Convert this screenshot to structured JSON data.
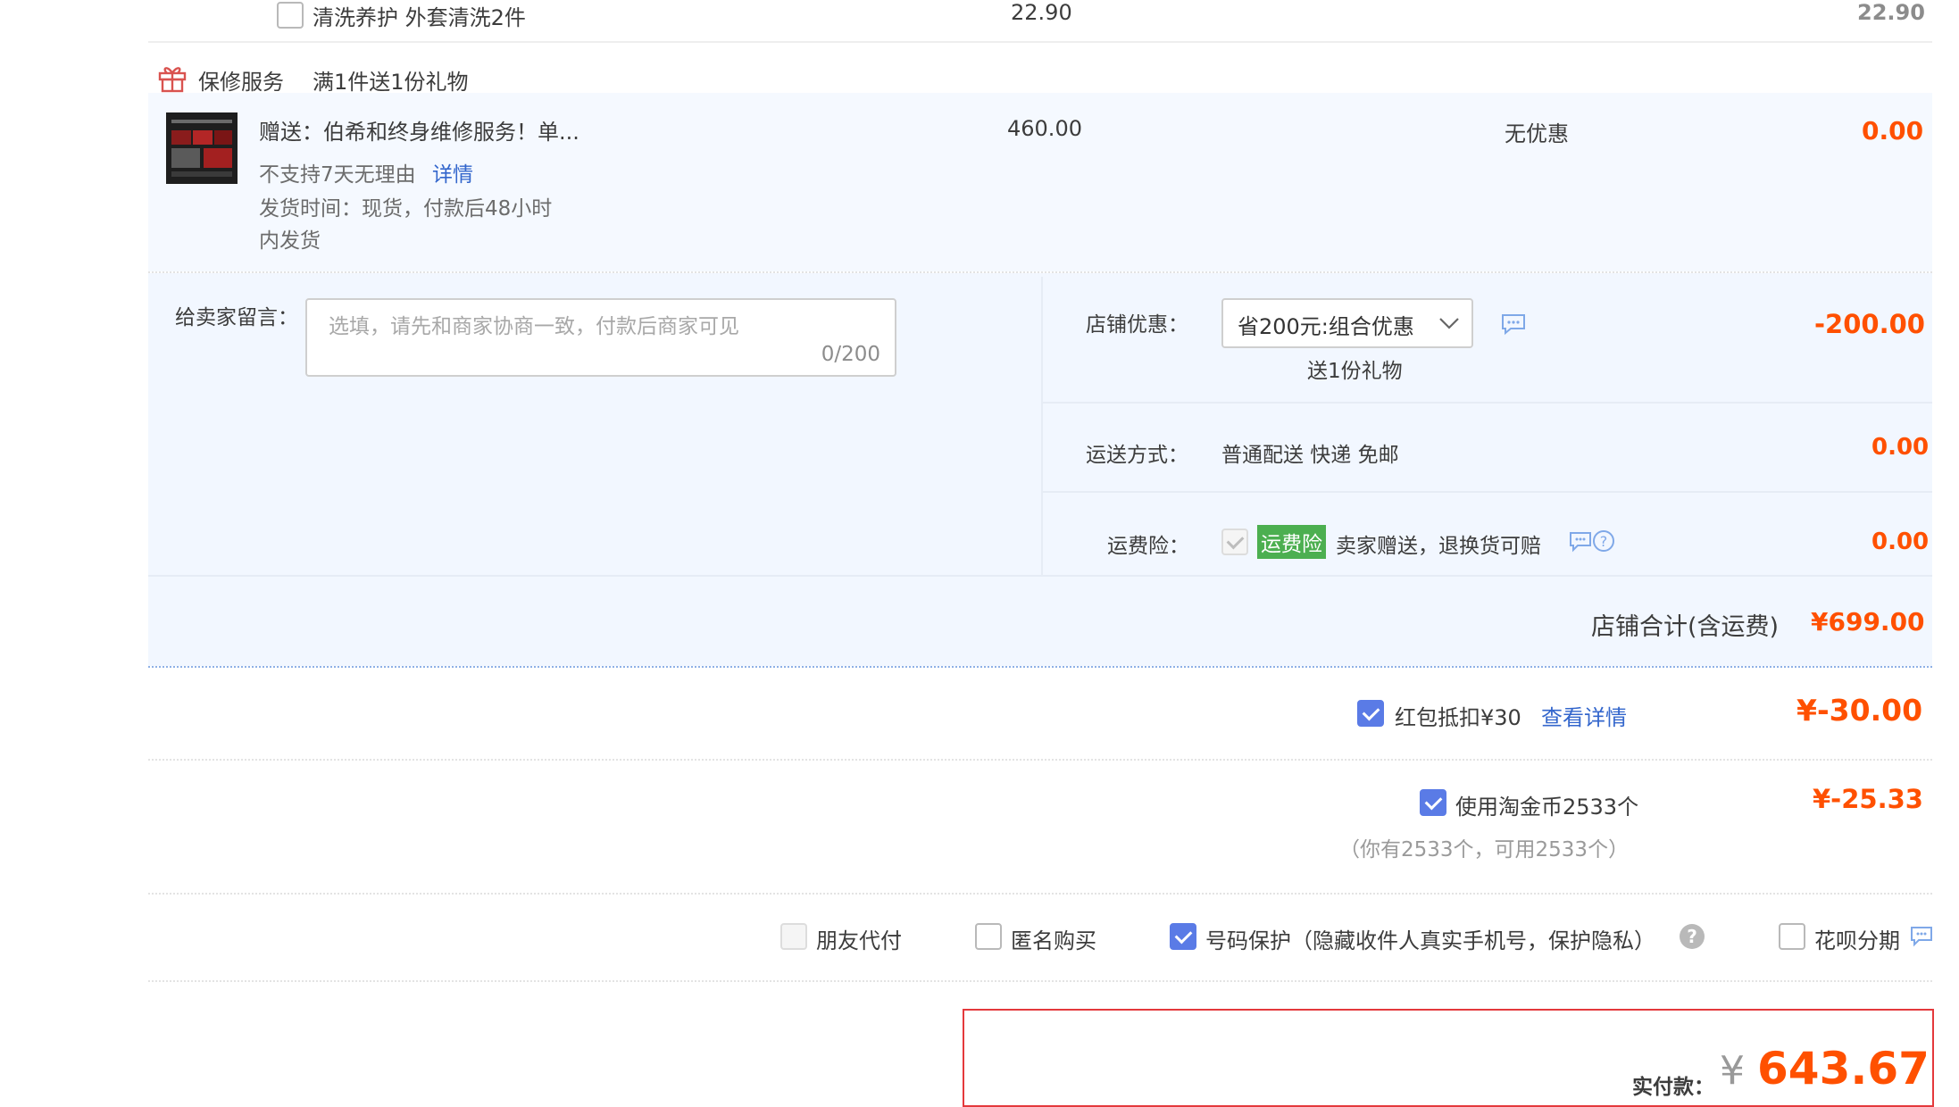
{
  "item_row": {
    "name": "清洗养护 外套清洗2件",
    "price": "22.90",
    "subtotal": "22.90"
  },
  "warranty": {
    "label": "保修服务",
    "promo": "满1件送1份礼物"
  },
  "gift_item": {
    "title": "赠送：伯希和终身维修服务！单...",
    "return_policy": "不支持7天无理由",
    "detail_link": "详情",
    "ship_time_line1": "发货时间：现货，付款后48小时",
    "ship_time_line2": "内发货",
    "price": "460.00",
    "discount": "无优惠",
    "subtotal": "0.00"
  },
  "message": {
    "label": "给卖家留言：",
    "placeholder": "选填，请先和商家协商一致，付款后商家可见",
    "counter": "0/200"
  },
  "store_discount": {
    "label": "店铺优惠：",
    "selected": "省200元:组合优惠",
    "note": "送1份礼物",
    "amount": "-200.00"
  },
  "shipping": {
    "label": "运送方式：",
    "method": "普通配送 快递 免邮",
    "amount": "0.00"
  },
  "insurance": {
    "label": "运费险：",
    "badge": "运费险",
    "text": "卖家赠送，退换货可赔",
    "amount": "0.00"
  },
  "store_total": {
    "label": "店铺合计(含运费)",
    "amount": "¥699.00"
  },
  "red_packet": {
    "label": "红包抵扣¥30",
    "link": "查看详情",
    "amount": "¥-30.00",
    "checked": true
  },
  "tao_coins": {
    "label": "使用淘金币2533个",
    "sub": "（你有2533个，可用2533个）",
    "amount": "¥-25.33",
    "checked": true
  },
  "options": {
    "friend_pay": "朋友代付",
    "anonymous": "匿名购买",
    "number_protect": "号码保护（隐藏收件人真实手机号，保护隐私）",
    "huabei": "花呗分期"
  },
  "actual_payment": {
    "label": "实付款：",
    "currency": "¥",
    "amount": "643.67"
  },
  "colors": {
    "accent": "#ff5000",
    "link": "#3366cc",
    "checkbox": "#5a7be6",
    "panel": "#f2f7ff",
    "badge": "#4caf50",
    "box_border": "#e4393c"
  },
  "icons": [
    "gift-icon",
    "chevron-down-icon",
    "chat-icon",
    "help-icon",
    "check-icon"
  ]
}
